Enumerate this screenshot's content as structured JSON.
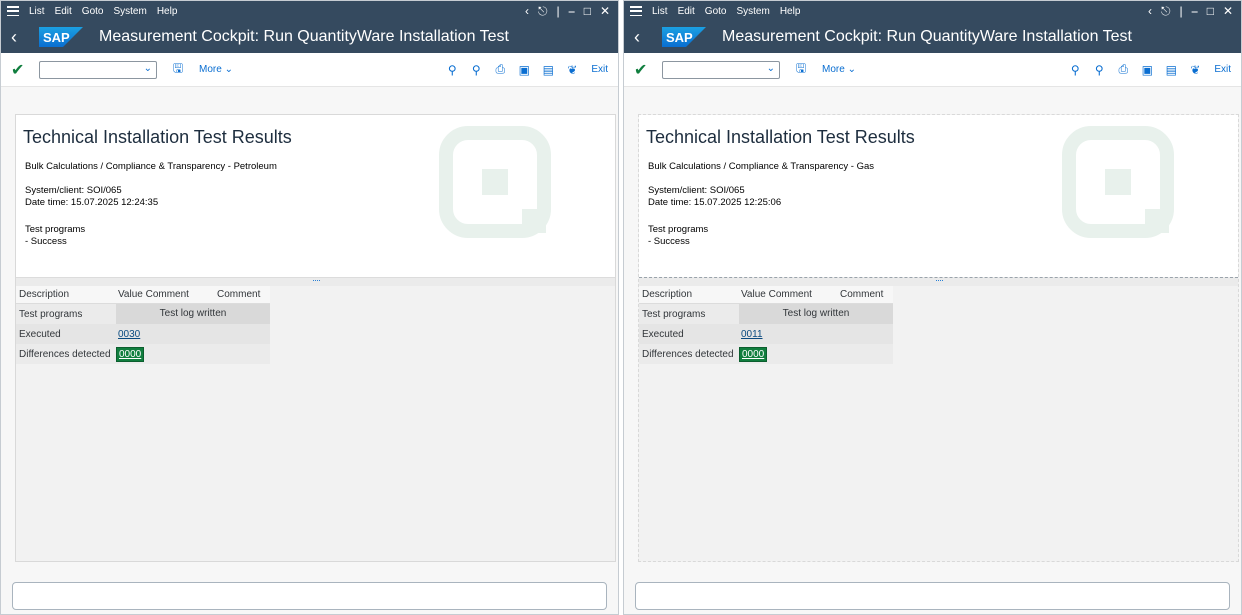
{
  "menu": {
    "list": "List",
    "edit": "Edit",
    "goto": "Goto",
    "system": "System",
    "help": "Help"
  },
  "title": "Measurement Cockpit: Run QuantityWare Installation Test",
  "toolbar": {
    "more": "More",
    "exit": "Exit"
  },
  "headings": {
    "report_title": "Technical Installation Test Results",
    "system_prefix": "System/client: SOI/065",
    "test_programs": "Test programs",
    "success": "- Success"
  },
  "grid_headers": {
    "description": "Description",
    "value_comment": "Value Comment",
    "comment": "Comment"
  },
  "grid_rows": {
    "test_programs": "Test programs",
    "test_log": "Test log written",
    "executed": "Executed",
    "differences": "Differences detected"
  },
  "left": {
    "subtitle": "Bulk Calculations / Compliance & Transparency - Petroleum",
    "date": "Date time: 15.07.2025 12:24:35",
    "executed_value": "0030",
    "differences_value": "0000"
  },
  "right": {
    "subtitle": "Bulk Calculations / Compliance & Transparency - Gas",
    "date": "Date time: 15.07.2025 12:25:06",
    "executed_value": "0011",
    "differences_value": "0000"
  },
  "colors": {
    "shell": "#354a5f",
    "accent": "#0a6ed1",
    "success_green": "#107e3e"
  },
  "icons": [
    "menu-icon",
    "back-icon",
    "check-icon",
    "save-icon",
    "search-icon",
    "search-next-icon",
    "print-icon",
    "window-icon",
    "window2-icon",
    "settings-icon",
    "lock-icon",
    "minimize-icon",
    "maximize-icon",
    "close-icon"
  ]
}
